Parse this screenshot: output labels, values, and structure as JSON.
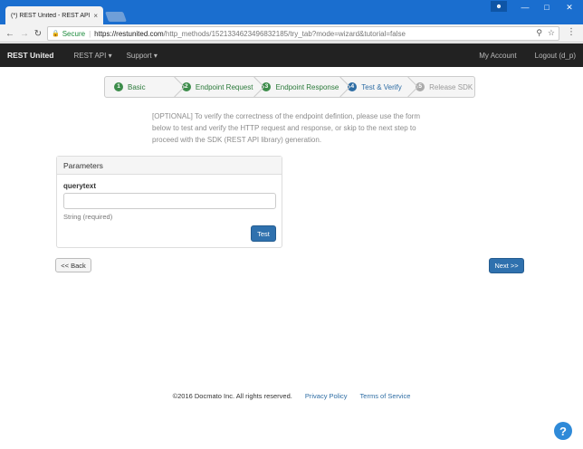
{
  "browser": {
    "tab_title": "(*) REST United - REST API",
    "tab_close": "×",
    "secure_label": "Secure",
    "url_host": "https://restunited.com",
    "url_path": "/http_methods/1521334623496832185/try_tab?mode=wizard&tutorial=false",
    "icons": [
      "back-arrow-icon",
      "forward-arrow-icon",
      "reload-icon",
      "lock-icon",
      "search-icon",
      "star-icon",
      "menu-dots-icon"
    ]
  },
  "navbar": {
    "brand": "REST United",
    "rest_api": "REST API ▾",
    "support": "Support ▾",
    "my_account": "My Account",
    "logout": "Logout (d_p)"
  },
  "wizard": {
    "steps": [
      {
        "num": "1",
        "label": "Basic"
      },
      {
        "num": "2",
        "label": "Endpoint Request"
      },
      {
        "num": "3",
        "label": "Endpoint Response"
      },
      {
        "num": "4",
        "label": "Test & Verify"
      },
      {
        "num": "5",
        "label": "Release SDK"
      }
    ]
  },
  "intro": "[OPTIONAL] To verify the correctness of the endpoint defintion, please use the form below to test and verify the HTTP request and response, or skip to the next step to proceed with the SDK (REST API library) generation.",
  "panel": {
    "title": "Parameters",
    "field_label": "querytext",
    "field_value": "",
    "field_help": "String (required)",
    "test_button": "Test"
  },
  "actions": {
    "back": "<< Back",
    "next": "Next >>"
  },
  "footer": {
    "copyright": "©2016 Docmato Inc. All rights reserved.",
    "privacy": "Privacy Policy",
    "terms": "Terms of Service"
  },
  "help_fab": "?"
}
